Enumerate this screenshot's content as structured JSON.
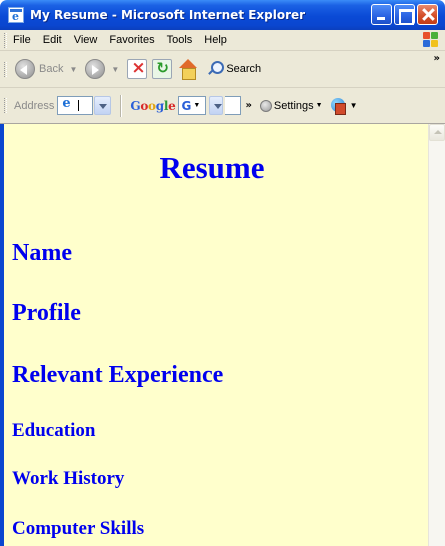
{
  "window": {
    "title": "My Resume - Microsoft Internet Explorer"
  },
  "menu": {
    "items": [
      "File",
      "Edit",
      "View",
      "Favorites",
      "Tools",
      "Help"
    ]
  },
  "toolbar": {
    "back_label": "Back",
    "search_label": "Search"
  },
  "address_bar": {
    "label": "Address"
  },
  "google_bar": {
    "logo": "Google",
    "settings_label": "Settings"
  },
  "page": {
    "background": "#ffffcc",
    "link_color": "#0000ee",
    "title": "Resume",
    "sections": [
      {
        "text": "Name",
        "level": "h2"
      },
      {
        "text": "Profile",
        "level": "h2"
      },
      {
        "text": "Relevant Experience",
        "level": "h2"
      },
      {
        "text": "Education",
        "level": "h3"
      },
      {
        "text": "Work History",
        "level": "h3"
      },
      {
        "text": "Computer Skills",
        "level": "h3"
      }
    ]
  }
}
